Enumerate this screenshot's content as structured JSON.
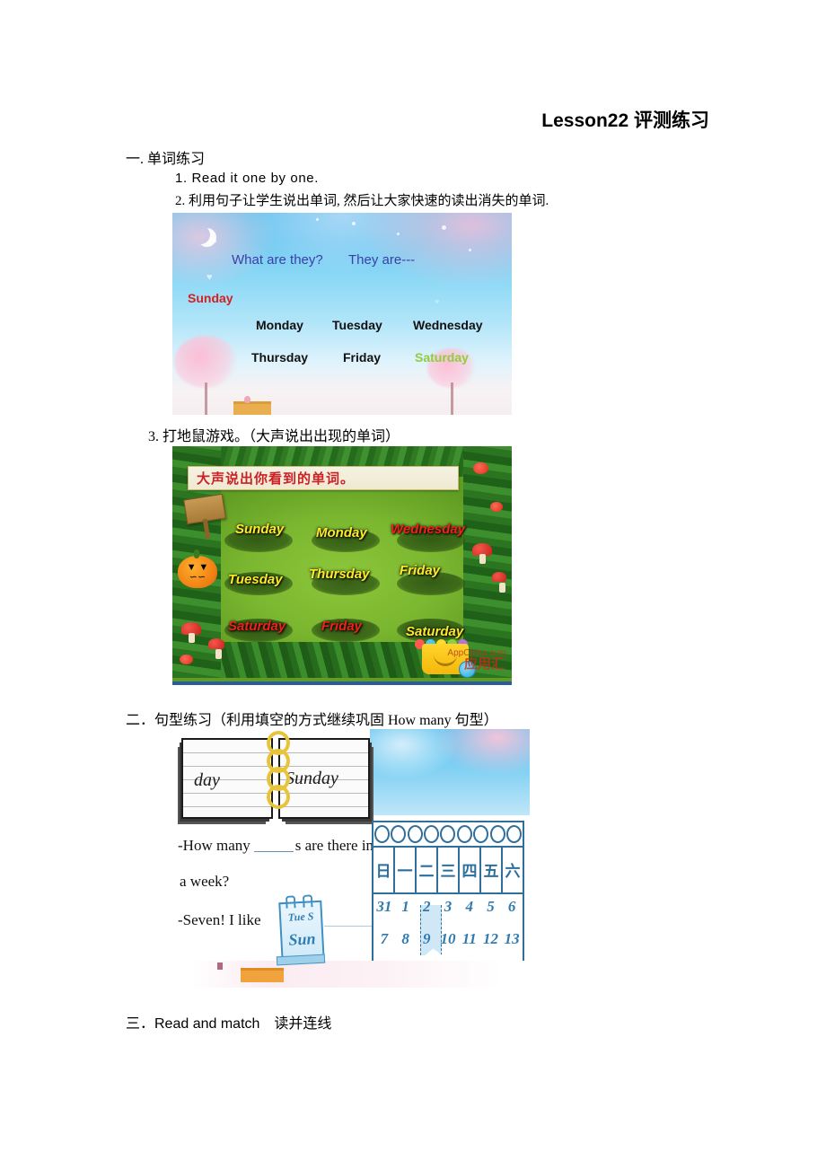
{
  "document": {
    "title": "Lesson22 评测练习"
  },
  "sections": [
    {
      "heading": "一. 单词练习",
      "items": [
        "1.  Read  it  one  by  one.",
        "2.  利用句子让学生说出单词, 然后让大家快速的读出消失的单词.",
        "3. 打地鼠游戏。（大声说出出现的单词）"
      ]
    },
    {
      "heading": "二．句型练习（利用填空的方式继续巩固 How  many 句型）"
    },
    {
      "heading": "三．Read and match　读并连线"
    }
  ],
  "slide_sky": {
    "question": "What are they?",
    "answer": "They are---",
    "sunday": "Sunday",
    "days": [
      {
        "label": "Monday",
        "color": "#111111"
      },
      {
        "label": "Tuesday",
        "color": "#111111"
      },
      {
        "label": "Wednesday",
        "color": "#111111"
      },
      {
        "label": "Thursday",
        "color": "#111111"
      },
      {
        "label": "Friday",
        "color": "#111111"
      },
      {
        "label": "Saturday",
        "color": "#8ece3a"
      }
    ],
    "sunday_color": "#d42020",
    "question_color": "#3a3fa8"
  },
  "game": {
    "banner": "大声说出你看到的单词。",
    "banner_color": "#cc2026",
    "words": [
      {
        "text": "Sunday",
        "color": "yellow"
      },
      {
        "text": "Monday",
        "color": "yellow"
      },
      {
        "text": "Wednesday",
        "color": "red"
      },
      {
        "text": "Tuesday",
        "color": "yellow"
      },
      {
        "text": "Thursday",
        "color": "yellow"
      },
      {
        "text": "Friday",
        "color": "yellow"
      },
      {
        "text": "Saturday",
        "color": "red"
      },
      {
        "text": "Friday",
        "color": "red"
      },
      {
        "text": "Saturday",
        "color": "yellow"
      }
    ],
    "watermark": "AppChina.com",
    "watermark2": "应用汇"
  },
  "sheet": {
    "book_left_word": "day",
    "book_right_word": "Sunday",
    "line1_a": "-How many",
    "line1_b": "s  are there in",
    "line2": "a week?",
    "line3": "-Seven! I like",
    "calendar_top": "Tue S",
    "calendar_bottom": "Sun",
    "week_days": [
      "日",
      "一",
      "二",
      "三",
      "四",
      "五",
      "六"
    ],
    "week_nums_row1": [
      "31",
      "1",
      "2",
      "3",
      "4",
      "5",
      "6"
    ],
    "week_nums_row2": [
      "7",
      "8",
      "9",
      "10",
      "11",
      "12",
      "13"
    ],
    "ink_color": "#2f6f9e"
  }
}
